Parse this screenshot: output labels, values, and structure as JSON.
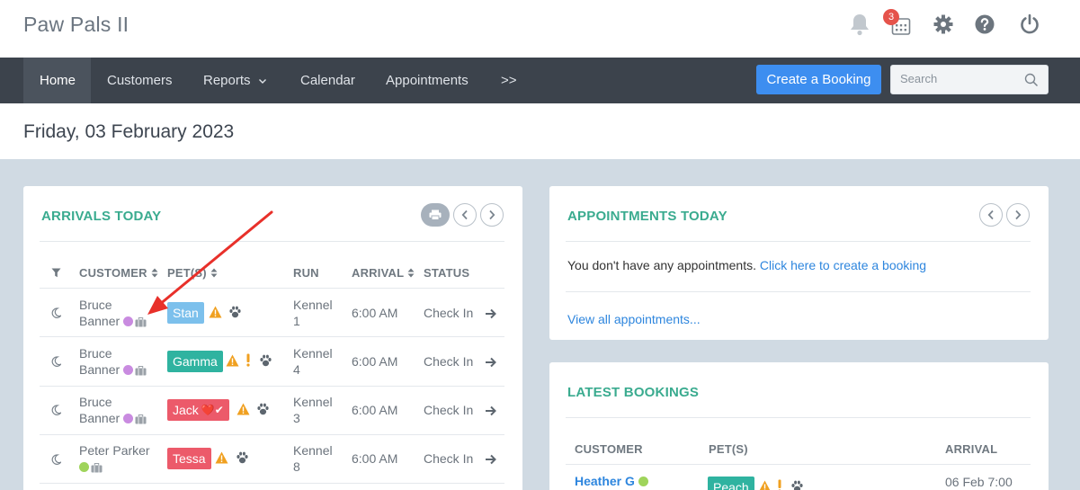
{
  "app": {
    "title": "Paw Pals II",
    "notification_count": "3"
  },
  "nav": {
    "items": [
      "Home",
      "Customers",
      "Reports",
      "Calendar",
      "Appointments",
      ">>"
    ],
    "booking_button": "Create a Booking",
    "search_placeholder": "Search"
  },
  "date_title": "Friday, 03 February 2023",
  "arrivals": {
    "title": "ARRIVALS TODAY",
    "columns": [
      "CUSTOMER",
      "PET(S)",
      "RUN",
      "ARRIVAL",
      "STATUS"
    ],
    "rows": [
      {
        "customer_first": "Bruce",
        "customer_last": "Banner",
        "dot_color": "#c98be0",
        "pet": "Stan",
        "pet_color": "#7cc0ec",
        "pet_extra": "",
        "run_a": "Kennel",
        "run_b": "1",
        "arrival": "6:00 AM",
        "status": "Check In"
      },
      {
        "customer_first": "Bruce",
        "customer_last": "Banner",
        "dot_color": "#c98be0",
        "pet": "Gamma",
        "pet_color": "#2fb3a0",
        "pet_extra": "",
        "run_a": "Kennel",
        "run_b": "4",
        "arrival": "6:00 AM",
        "status": "Check In"
      },
      {
        "customer_first": "Bruce",
        "customer_last": "Banner",
        "dot_color": "#c98be0",
        "pet": "Jack",
        "pet_color": "#ec5a6a",
        "pet_extra": "❤️✔",
        "run_a": "Kennel",
        "run_b": "3",
        "arrival": "6:00 AM",
        "status": "Check In"
      },
      {
        "customer_first": "Peter Parker",
        "customer_last": "",
        "dot_color": "#9fd45b",
        "pet": "Tessa",
        "pet_color": "#ec5a6a",
        "pet_extra": "",
        "run_a": "Kennel",
        "run_b": "8",
        "arrival": "6:00 AM",
        "status": "Check In"
      }
    ]
  },
  "appointments": {
    "title": "APPOINTMENTS TODAY",
    "empty_text": "You don't have any appointments.",
    "create_link": "Click here to create a booking",
    "view_all": "View all appointments..."
  },
  "latest": {
    "title": "LATEST BOOKINGS",
    "columns": [
      "CUSTOMER",
      "PET(S)",
      "ARRIVAL"
    ],
    "rows": [
      {
        "customer": "Heather G",
        "dot_color": "#9fd45b",
        "pet": "Peach",
        "pet_color": "#2fb3a0",
        "arrival": "06 Feb 7:00"
      }
    ]
  },
  "colors": {
    "accent": "#3aab8f",
    "nav_bg": "#3c434c",
    "primary": "#3d8ef0",
    "warning": "#f0a020",
    "annotation": "#e8302a"
  }
}
